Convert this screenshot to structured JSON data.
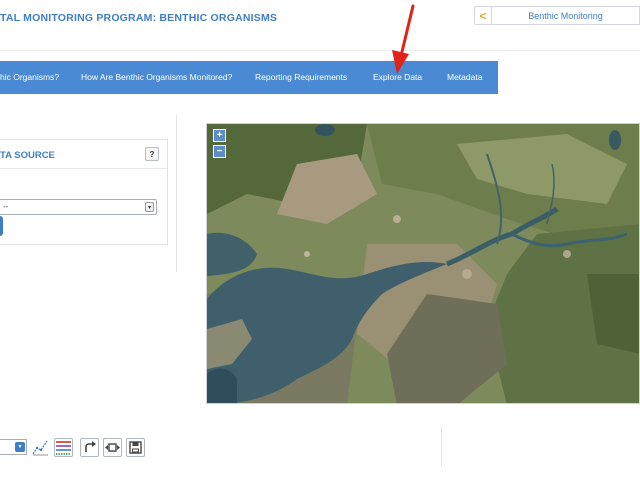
{
  "header": {
    "title": "TAL MONITORING PROGRAM: BENTHIC ORGANISMS",
    "back_symbol": "<",
    "breadcrumb": "Benthic Monitoring"
  },
  "nav": {
    "items": [
      "hic Organisms?",
      "How Are Benthic Organisms Monitored?",
      "Reporting Requirements",
      "Explore Data",
      "Metadata"
    ]
  },
  "panel": {
    "title": "TA SOURCE",
    "help": "?",
    "select_value": "--"
  },
  "map": {
    "zoom_in": "+",
    "zoom_out": "−"
  },
  "toolbar": {
    "tools": [
      "trend-line-icon",
      "legend-lines-icon",
      "redo-icon",
      "expand-icon",
      "save-icon"
    ]
  },
  "colors": {
    "accent": "#3f7ec6",
    "nav_bg": "#4a8ad4",
    "arrow": "#e2231a",
    "breadcrumb_back": "#f0a52a"
  }
}
